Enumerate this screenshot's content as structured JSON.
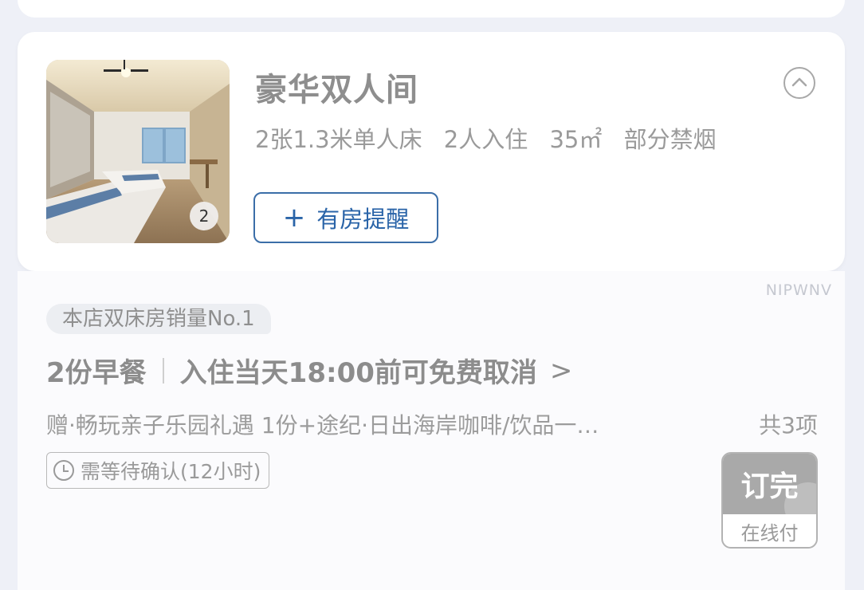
{
  "room": {
    "name": "豪华双人间",
    "specs": {
      "bed": "2张1.3米单人床",
      "occupancy": "2人入住",
      "area": "35㎡",
      "smoking": "部分禁烟"
    },
    "photo_count": "2",
    "alert_button": {
      "icon": "plus-icon",
      "label": "有房提醒"
    },
    "collapse_icon": "chevron-up-icon"
  },
  "watermark": "NIPWNV",
  "plan": {
    "badge": "本店双床房销量No.1",
    "breakfast": "2份早餐",
    "cancel_policy": "入住当天18:00前可免费取消",
    "chevron": ">",
    "gifts": "赠·畅玩亲子乐园礼遇 1份+途纪·日出海岸咖啡/饮品一…",
    "gifts_total": "共3项",
    "confirm": "需等待确认(12小时)",
    "book": {
      "status": "订完",
      "payment": "在线付"
    }
  },
  "colors": {
    "background": "#eef0f7",
    "card": "#ffffff",
    "accent": "#2a64a8",
    "disabled": "#a9a9a9"
  }
}
